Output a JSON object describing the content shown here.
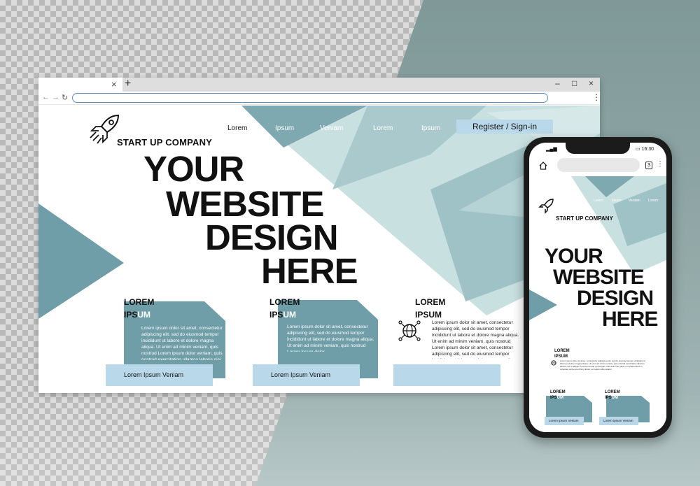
{
  "browser": {
    "tab_close": "×",
    "new_tab": "+",
    "controls": {
      "minimize": "–",
      "maximize": "□",
      "close": "×"
    },
    "nav": {
      "back": "←",
      "forward": "→",
      "reload": "↻"
    },
    "address_value": "",
    "menu": "⋮"
  },
  "site": {
    "company_name": "START UP COMPANY",
    "nav_links": [
      "Lorem",
      "Ipsum",
      "Veniam",
      "Lorem",
      "Ipsum"
    ],
    "register_label": "Register / Sign-in",
    "hero_lines": [
      "YOUR",
      "WEBSITE",
      "DESIGN",
      "HERE"
    ],
    "features": [
      {
        "title_dark_1": "LOREM",
        "title_dark_2": "IPS",
        "title_light": "UM",
        "text": "Lorem ipsum dolor sit amet, consectetur adipiscing elit, sed do eiusmod tempor incididunt ut labore et dolore magna aliqua. Ut enim ad minim veniam, quis nostrud Lorem ipsum dolor veniam, quis nostrud exercitation ullamco laboris nisi ut",
        "button": "Lorem Ipsum Veniam"
      },
      {
        "title_dark_1": "LOREM",
        "title_dark_2": "IPS",
        "title_light": "UM",
        "text": "Lorem ipsum dolor sit amet, consectetur adipiscing elit, sed do eiusmod tempor incididunt ut labore et dolore magna aliqua. Ut enim ad minim veniam, quis nostrud Lorem ipsum dolor",
        "button": "Lorem Ipsum Veniam"
      },
      {
        "title_dark_1": "LOREM",
        "title_dark_2": "IPSUM",
        "title_light": "",
        "text": "Lorem ipsum dolor sit amet, consectetur adipiscing elit, sed do eiusmod tempor incididunt ut labore et dolore magna aliqua. Ut enim ad minim veniam, quis nostrud Lorem ipsum dolor sit amet, consectetur adipiscing elit, sed do eiusmod tempor incididunt ut labore et dolore magna aliqua. Ut enim ad minim veniam, quis nostrud exercitation ullamco",
        "button": ""
      }
    ]
  },
  "phone": {
    "signal": "▂▄▆",
    "time": "16:30",
    "tab_count": "3",
    "menu": "⋮",
    "address_value": "",
    "nav_links": [
      "Lorem",
      "Ipsum",
      "Veniam",
      "Lorem"
    ],
    "company_name": "START UP COMPANY",
    "hero_lines": [
      "YOUR",
      "WEBSITE",
      "DESIGN",
      "HERE"
    ],
    "section_title_1": "LOREM",
    "section_title_2": "IPSUM",
    "section_text": "Lorem ipsum dolor sit amet, consectetur adipiscing elit, sed do eiusmod tempor incididunt ut labore et dolore magna aliqua. Ut enim ad minim veniam, quis nostrud exercitation ullamco laboris nisi ut aliquip ex ea commodo consequat. Duis aute irure dolor in reprehenderit in voluptate velit esse cillum dolore eu fugiat nulla pariatur.",
    "cards": [
      {
        "title_dark_1": "LOREM",
        "title_dark_2": "IPS",
        "title_light": "UM",
        "button": "Lorem Ipsum Veniam"
      },
      {
        "title_dark_1": "LOREM",
        "title_dark_2": "IPS",
        "title_light": "UM",
        "button": "Lorem Ipsum Veniam"
      }
    ]
  },
  "colors": {
    "accent_teal": "#6f9da8",
    "accent_light_blue": "#b9d8ea",
    "background_teal": "#8ea3a3"
  }
}
